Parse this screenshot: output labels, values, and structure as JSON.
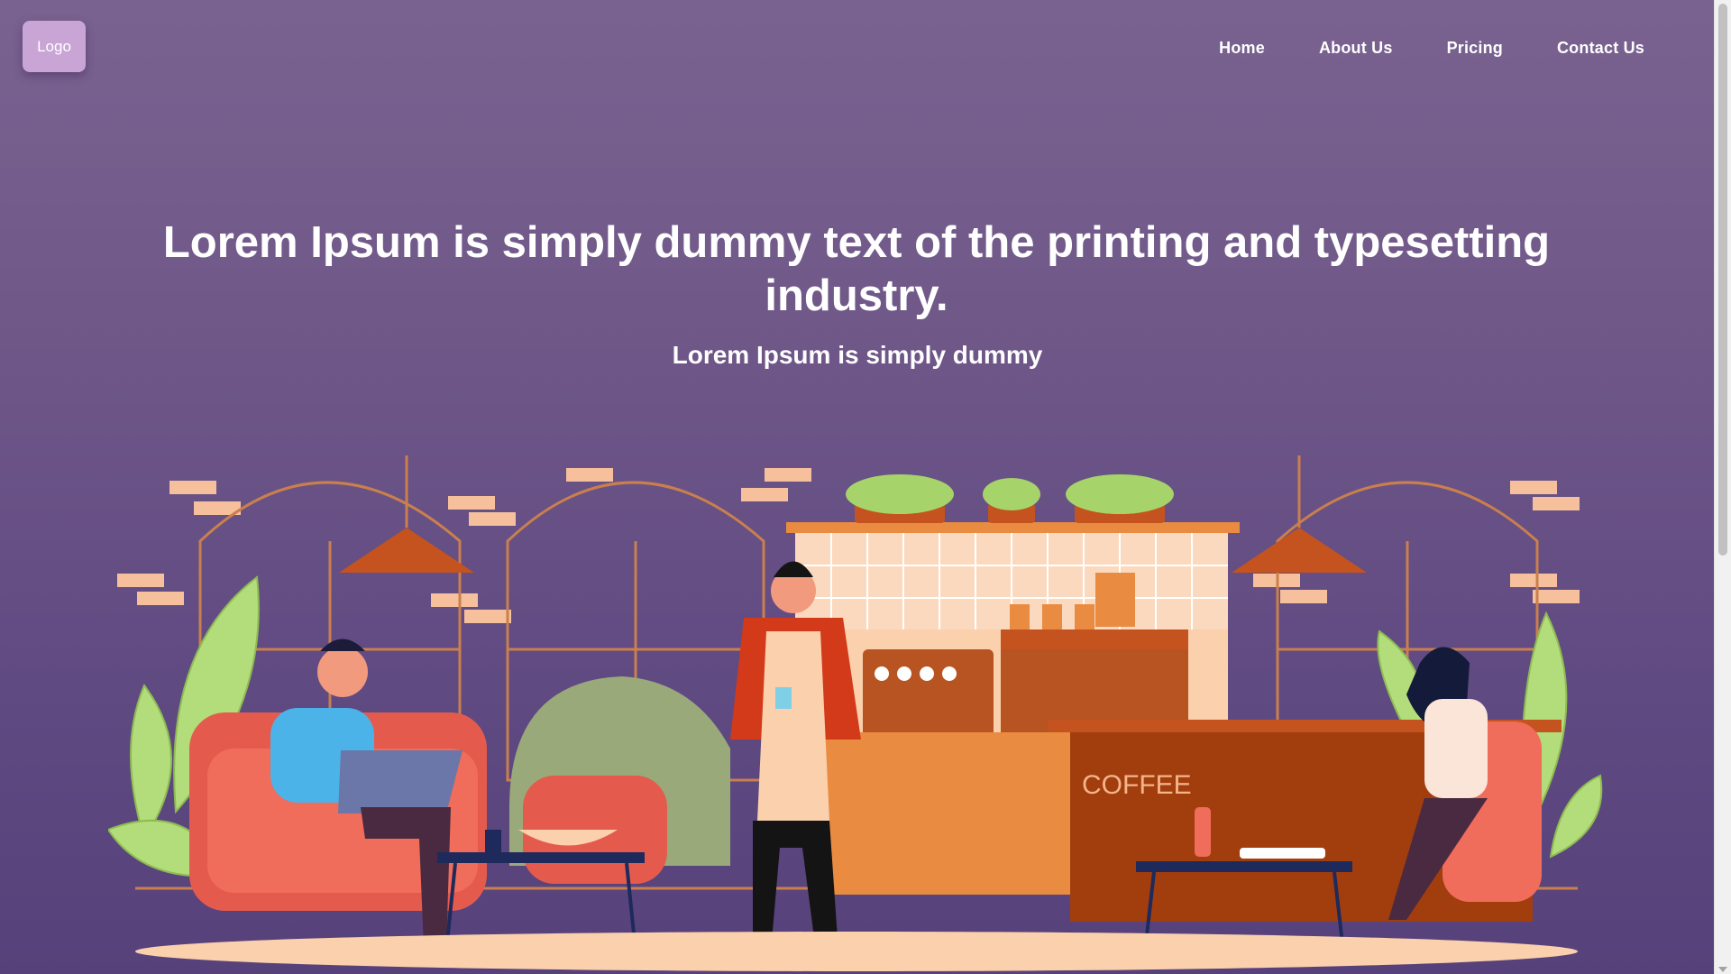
{
  "header": {
    "logo_label": "Logo",
    "nav": [
      {
        "label": "Home"
      },
      {
        "label": "About Us"
      },
      {
        "label": "Pricing"
      },
      {
        "label": "Contact Us"
      }
    ]
  },
  "hero": {
    "title": "Lorem Ipsum is simply dummy text of the printing and typesetting industry.",
    "subtitle": "Lorem Ipsum is simply dummy"
  },
  "illustration": {
    "counter_sign": "COFFEE"
  },
  "colors": {
    "background_top": "#7a6290",
    "background_bottom": "#57417a",
    "logo_bg": "#c9a5d6",
    "accent_orange": "#e98b40",
    "accent_coral": "#f06c5b",
    "leaf_green": "#b3dc7a"
  }
}
